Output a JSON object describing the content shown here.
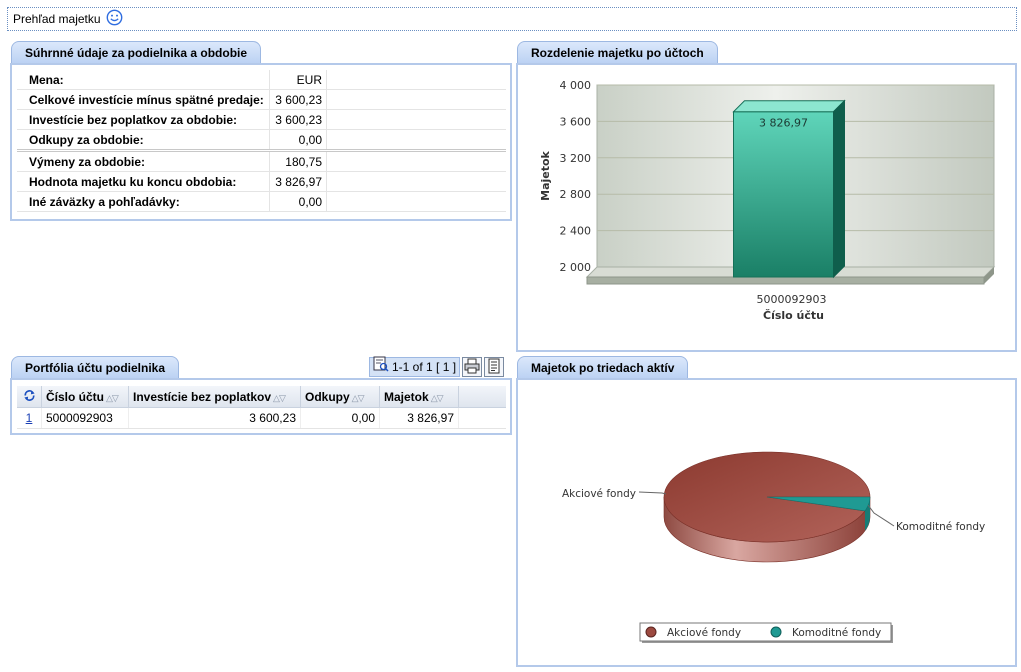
{
  "page": {
    "title": "Prehľad majetku"
  },
  "summary": {
    "title": "Súhrnné údaje za podielnika a obdobie",
    "rows": [
      {
        "label": "Mena:",
        "value": "EUR"
      },
      {
        "label": "Celkové investície mínus spätné predaje:",
        "value": "3 600,23"
      },
      {
        "label": "Investície bez poplatkov za obdobie:",
        "value": "3 600,23"
      },
      {
        "label": "Odkupy za obdobie:",
        "value": "0,00"
      },
      {
        "label": "Výmeny za obdobie:",
        "value": "180,75"
      },
      {
        "label": "Hodnota majetku ku koncu obdobia:",
        "value": "3 826,97"
      },
      {
        "label": "Iné záväzky a pohľadávky:",
        "value": "0,00"
      }
    ]
  },
  "portfolio": {
    "title": "Portfólia účtu podielnika",
    "pager_text": "1-1 of 1 [ 1 ]",
    "columns": [
      "Číslo účtu",
      "Investície bez poplatkov",
      "Odkupy",
      "Majetok"
    ],
    "rows": [
      {
        "index": "1",
        "account": "5000092903",
        "investments": "3 600,23",
        "redemptions": "0,00",
        "assets": "3 826,97"
      }
    ]
  },
  "bar_panel": {
    "title": "Rozdelenie majetku po účtoch"
  },
  "pie_panel": {
    "title": "Majetok po triedach aktív"
  },
  "chart_data": [
    {
      "type": "bar",
      "title": "",
      "xlabel": "Číslo účtu",
      "ylabel": "Majetok",
      "categories": [
        "5000092903"
      ],
      "values": [
        3826.97
      ],
      "value_labels": [
        "3 826,97"
      ],
      "ylim": [
        2000,
        4000
      ],
      "yticks": [
        "2 000",
        "2 400",
        "2 800",
        "3 200",
        "3 600",
        "4 000"
      ],
      "grid": true,
      "color": "#2aa88a"
    },
    {
      "type": "pie",
      "labels": [
        "Akciové fondy",
        "Komoditné fondy"
      ],
      "values": [
        95,
        5
      ],
      "colors": [
        "#9c4a40",
        "#1f9a93"
      ],
      "legend": "bottom"
    }
  ]
}
